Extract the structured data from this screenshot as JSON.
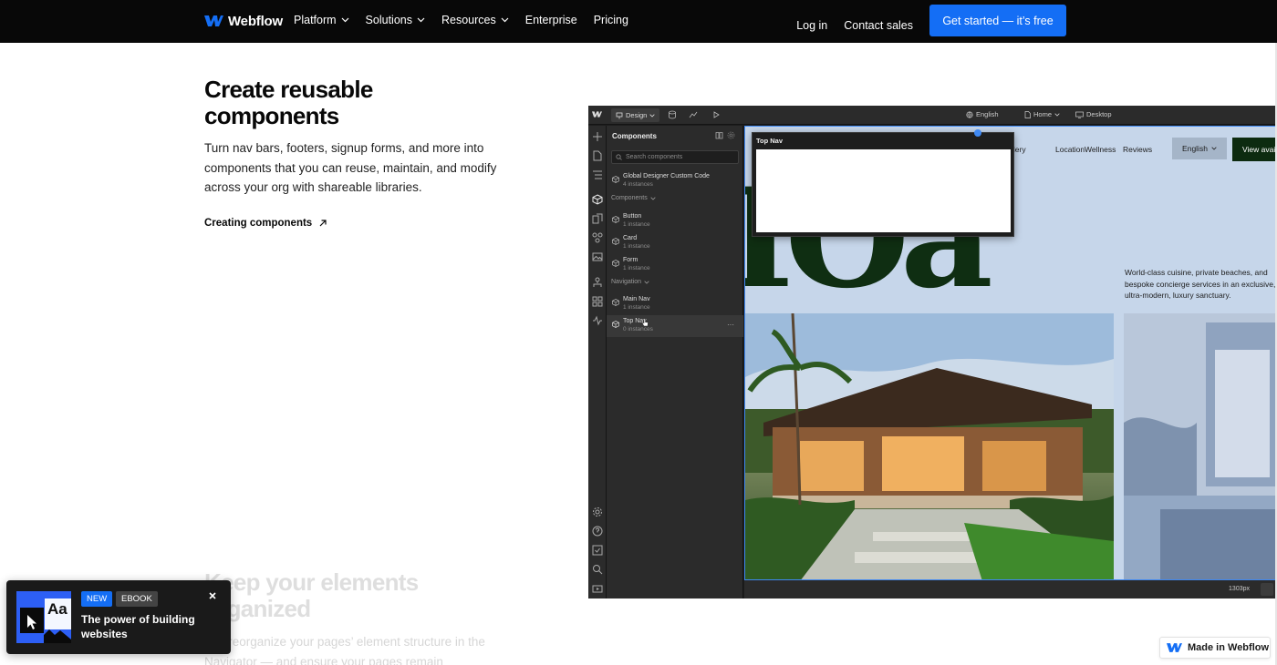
{
  "nav": {
    "brand": "Webflow",
    "links": [
      {
        "label": "Platform",
        "dropdown": true
      },
      {
        "label": "Solutions",
        "dropdown": true
      },
      {
        "label": "Resources",
        "dropdown": true
      },
      {
        "label": "Enterprise",
        "dropdown": false
      },
      {
        "label": "Pricing",
        "dropdown": false
      }
    ],
    "login": "Log in",
    "contact": "Contact sales",
    "cta": "Get started — it’s free"
  },
  "hero": {
    "title": "Create reusable components",
    "description": "Turn nav bars, footers, signup forms, and more into components that you can reuse, maintain, and modify across your org with shareable libraries.",
    "link": "Creating components"
  },
  "next_section": {
    "title": "Keep your elements organized",
    "description": "and reorganize your pages’ element structure in the Navigator — and ensure your pages remain"
  },
  "editor": {
    "mode": "Design",
    "language": "English",
    "page": "Home",
    "breakpoint": "Desktop",
    "panel_title": "Components",
    "search_placeholder": "Search components",
    "global_item": {
      "name": "Global Designer Custom Code",
      "count": "4 instances"
    },
    "groups": [
      {
        "label": "Components",
        "items": [
          {
            "name": "Button",
            "count": "1 instance"
          },
          {
            "name": "Card",
            "count": "1 instance"
          },
          {
            "name": "Form",
            "count": "1 instance"
          }
        ]
      },
      {
        "label": "Navigation",
        "items": [
          {
            "name": "Main Nav",
            "count": "1 instance"
          },
          {
            "name": "Top Nav",
            "count": "0 instances"
          }
        ]
      }
    ],
    "popup_title": "Top Nav",
    "canvas": {
      "nav_links": [
        "llery",
        "Location",
        "Wellness",
        "Reviews"
      ],
      "language": "English",
      "cta": "View avai",
      "headline": "IOa",
      "copy": "World-class cuisine, private beaches, and bespoke concierge services in an exclusive, ultra-modern, luxury sanctuary."
    },
    "width_readout": "1303px"
  },
  "toast": {
    "badge_new": "NEW",
    "badge_type": "EBOOK",
    "title": "The power of building websites",
    "thumb_text": "Aa"
  },
  "footer_badge": "Made in Webflow",
  "colors": {
    "accent": "#146ef5",
    "nav_bg": "#080808",
    "forest": "#0f2e12"
  }
}
